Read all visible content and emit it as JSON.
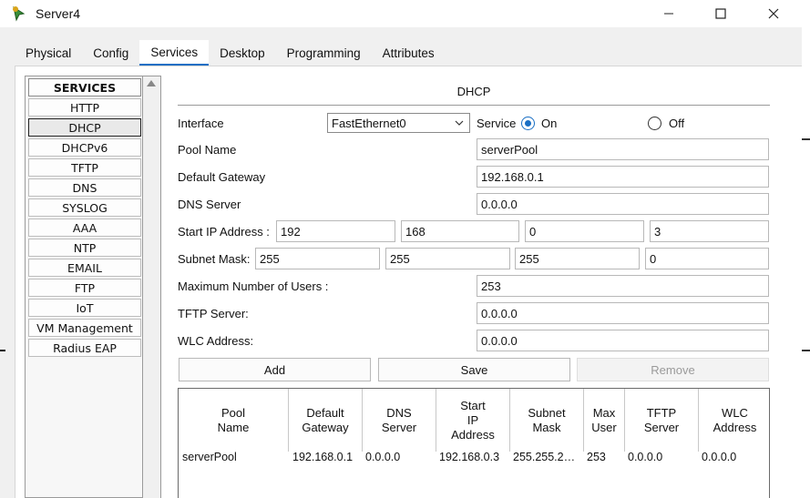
{
  "window": {
    "title": "Server4",
    "controls": {
      "minimize": "—",
      "maximize": "☐",
      "close": "✕"
    }
  },
  "tabs": [
    {
      "label": "Physical"
    },
    {
      "label": "Config"
    },
    {
      "label": "Services",
      "active": true
    },
    {
      "label": "Desktop"
    },
    {
      "label": "Programming"
    },
    {
      "label": "Attributes"
    }
  ],
  "services": {
    "header": "SERVICES",
    "items": [
      "HTTP",
      "DHCP",
      "DHCPv6",
      "TFTP",
      "DNS",
      "SYSLOG",
      "AAA",
      "NTP",
      "EMAIL",
      "FTP",
      "IoT",
      "VM Management",
      "Radius EAP"
    ],
    "selected": "DHCP"
  },
  "dhcp": {
    "title": "DHCP",
    "interface_label": "Interface",
    "interface_value": "FastEthernet0",
    "service_label": "Service",
    "on_label": "On",
    "off_label": "Off",
    "service_state": "On",
    "pool_name_label": "Pool Name",
    "pool_name": "serverPool",
    "gateway_label": "Default Gateway",
    "gateway": "192.168.0.1",
    "dns_label": "DNS Server",
    "dns": "0.0.0.0",
    "start_ip_label": "Start IP Address :",
    "start_ip": [
      "192",
      "168",
      "0",
      "3"
    ],
    "subnet_label": "Subnet Mask:",
    "subnet": [
      "255",
      "255",
      "255",
      "0"
    ],
    "max_users_label": "Maximum Number of Users :",
    "max_users": "253",
    "tftp_label": "TFTP Server:",
    "tftp": "0.0.0.0",
    "wlc_label": "WLC Address:",
    "wlc": "0.0.0.0",
    "buttons": {
      "add": "Add",
      "save": "Save",
      "remove": "Remove"
    }
  },
  "table": {
    "columns": [
      [
        "Pool",
        "Name"
      ],
      [
        "Default",
        "Gateway"
      ],
      [
        "DNS",
        "Server"
      ],
      [
        "Start",
        "IP",
        "Address"
      ],
      [
        "Subnet",
        "Mask"
      ],
      [
        "Max",
        "User"
      ],
      [
        "TFTP",
        "Server"
      ],
      [
        "WLC",
        "Address"
      ]
    ],
    "rows": [
      [
        "serverPool",
        "192.168.0.1",
        "0.0.0.0",
        "192.168.0.3",
        "255.255.2…",
        "253",
        "0.0.0.0",
        "0.0.0.0"
      ]
    ]
  }
}
